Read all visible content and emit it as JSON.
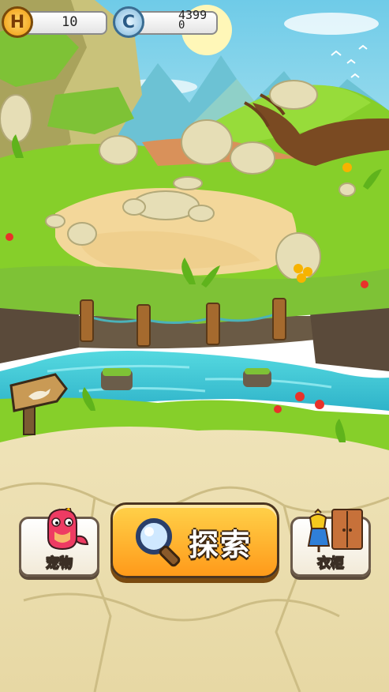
{
  "hud": {
    "honor_icon_letter": "H",
    "honor_value": "10",
    "coin_icon_letter": "C",
    "coin_value_main": "4399",
    "coin_value_sub": "0"
  },
  "buttons": {
    "pet_label": "宠物",
    "explore_label": "探索",
    "wardrobe_label": "衣柜"
  },
  "colors": {
    "sky": "#8fd8f0",
    "grass": "#86cf2a",
    "dirt": "#f4d89a",
    "water": "#3ec9d6",
    "explore_button": "#ffb52a",
    "honor_coin": "#f6a10b",
    "silver_coin": "#5aa9d8"
  },
  "icons": {
    "explore": "magnifier-icon",
    "pet": "pink-dinosaur-icon",
    "wardrobe": "wardrobe-icon",
    "sign": "dinosaur-signpost-icon"
  }
}
